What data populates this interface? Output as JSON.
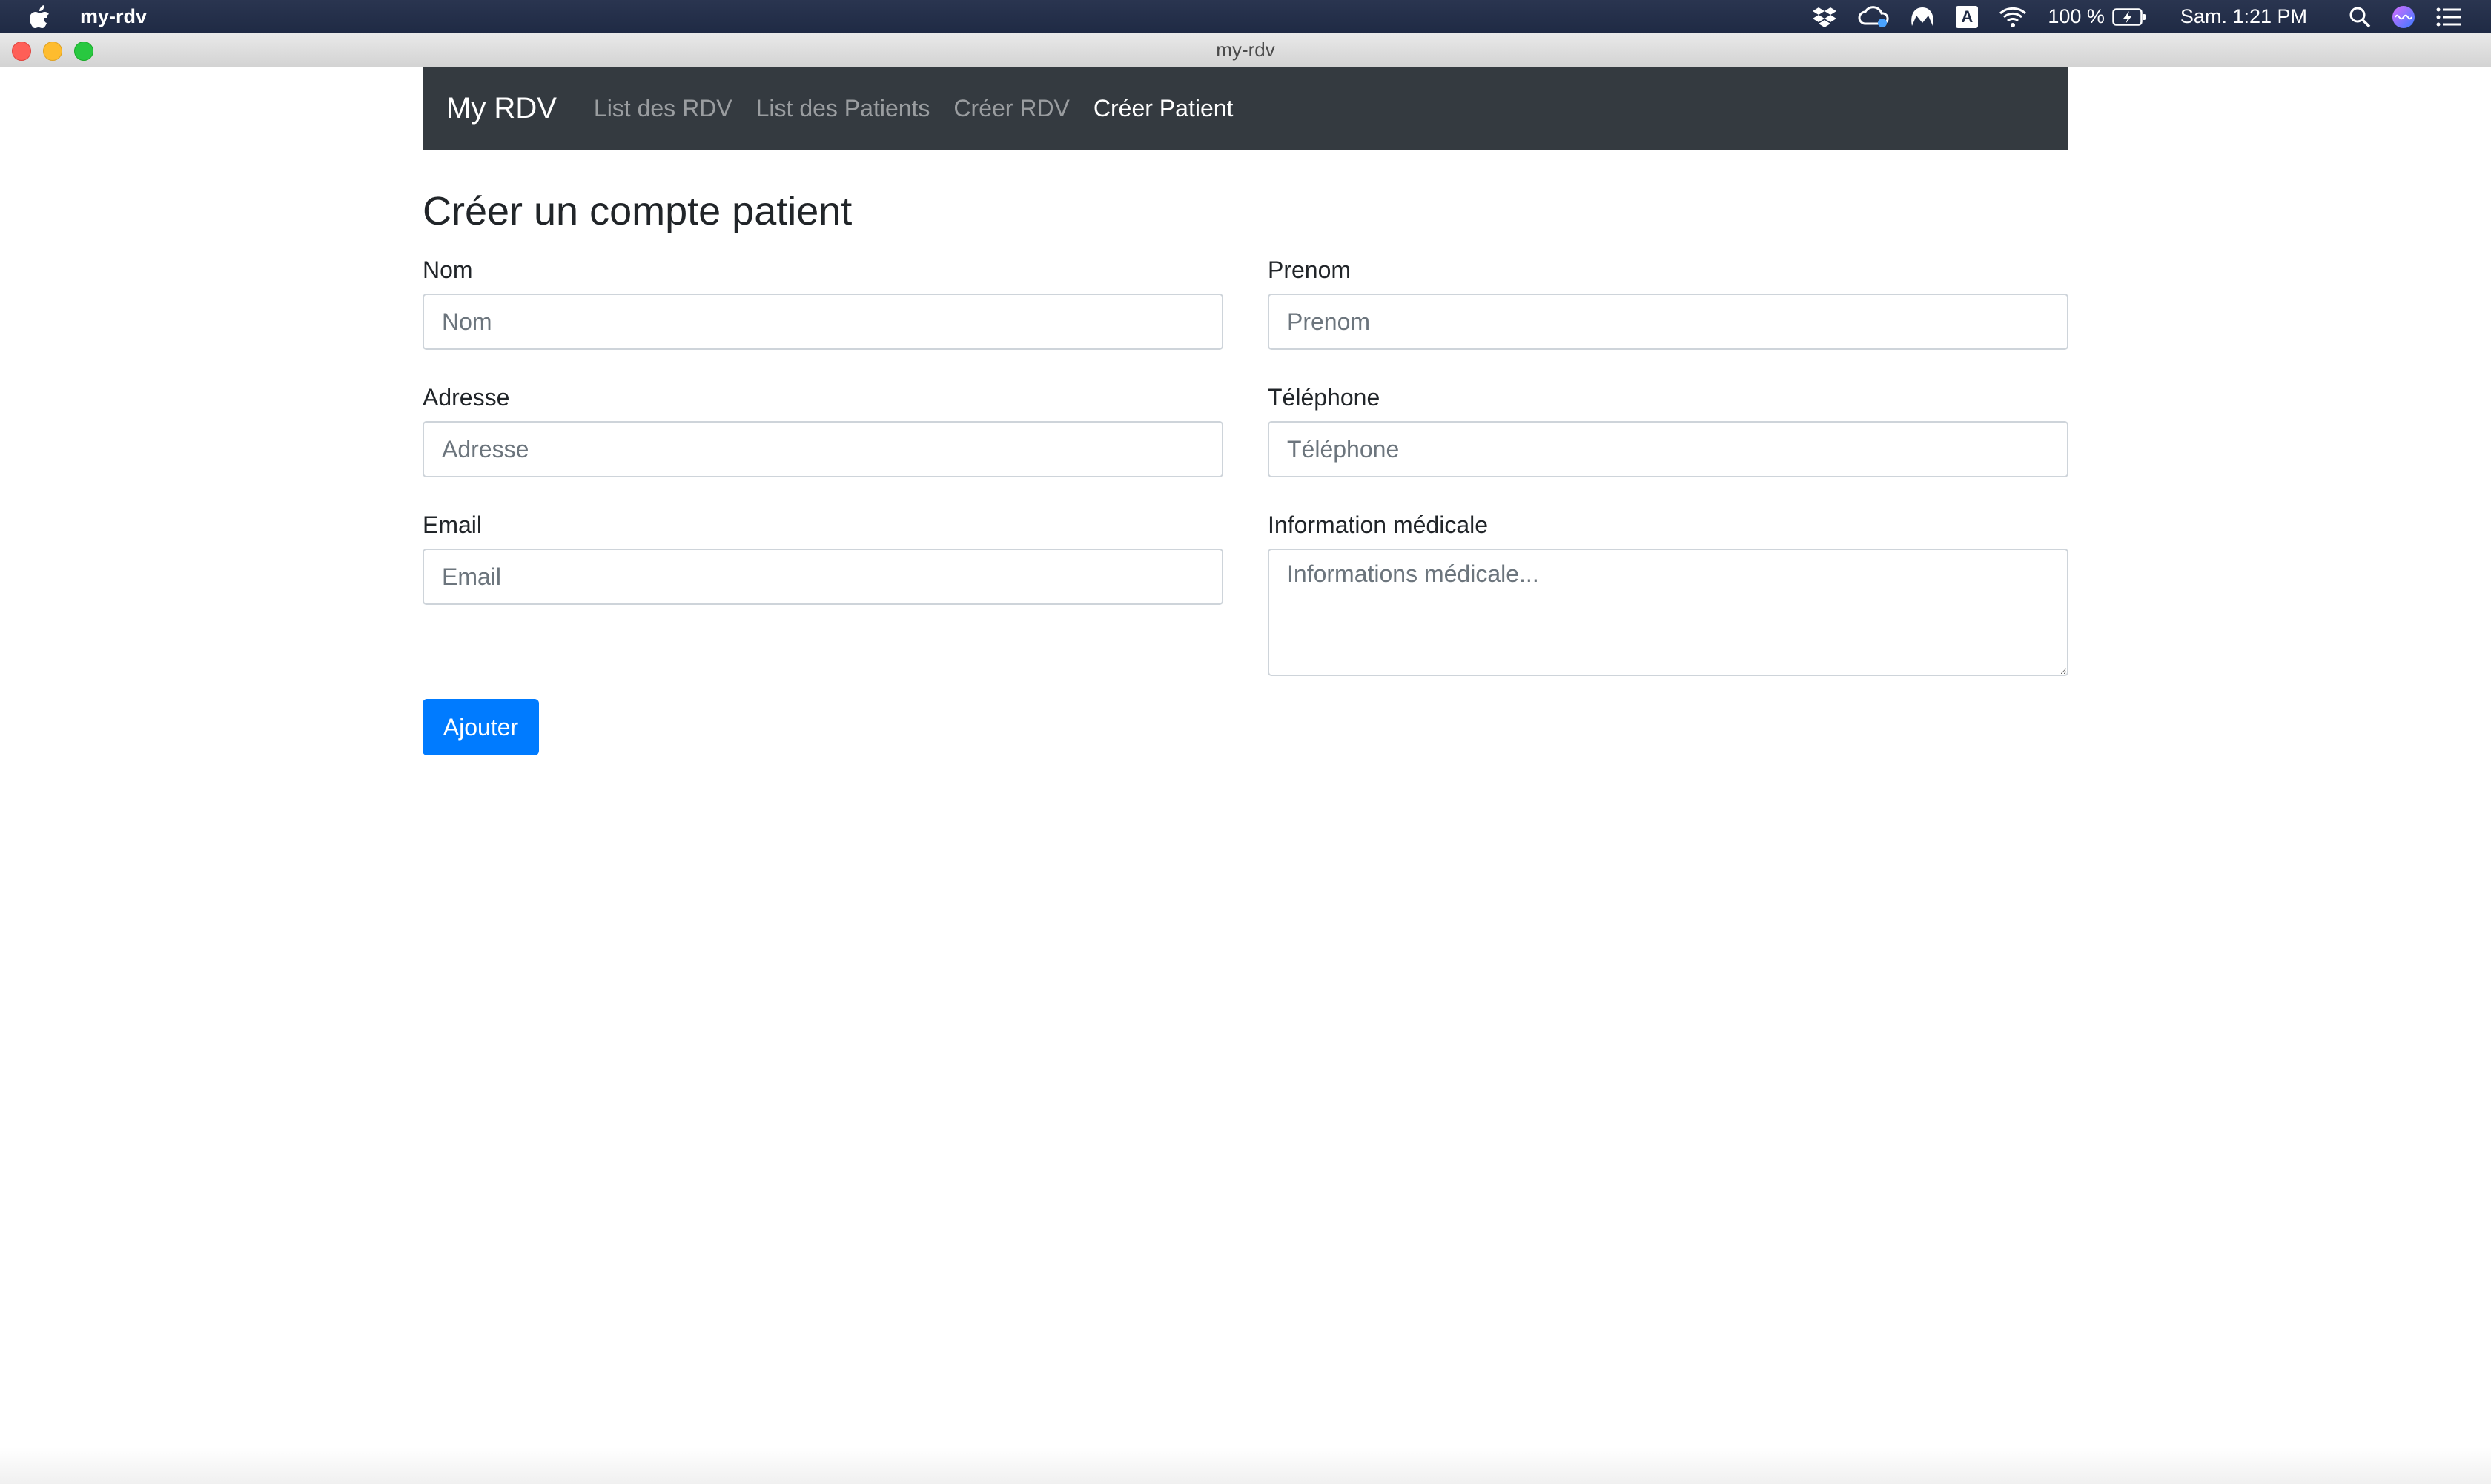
{
  "menubar": {
    "app_name": "my-rdv",
    "battery": "100 %",
    "clock": "Sam. 1:21 PM",
    "input_source": "A",
    "icons": [
      "apple-icon",
      "dropbox-icon",
      "creative-cloud-icon",
      "malwarebytes-icon",
      "input-source-icon",
      "wifi-icon",
      "battery-icon",
      "spotlight-icon",
      "siri-icon",
      "notification-center-icon"
    ]
  },
  "window": {
    "title": "my-rdv"
  },
  "navbar": {
    "brand": "My RDV",
    "links": [
      "List des RDV",
      "List des Patients",
      "Créer RDV",
      "Créer Patient"
    ],
    "active_index": 3
  },
  "form": {
    "title": "Créer un compte patient",
    "nom": {
      "label": "Nom",
      "placeholder": "Nom",
      "value": ""
    },
    "prenom": {
      "label": "Prenom",
      "placeholder": "Prenom",
      "value": ""
    },
    "adresse": {
      "label": "Adresse",
      "placeholder": "Adresse",
      "value": ""
    },
    "telephone": {
      "label": "Téléphone",
      "placeholder": "Téléphone",
      "value": ""
    },
    "email": {
      "label": "Email",
      "placeholder": "Email",
      "value": ""
    },
    "info_medicale": {
      "label": "Information médicale",
      "placeholder": "Informations médicale...",
      "value": ""
    },
    "submit_label": "Ajouter"
  },
  "colors": {
    "navbar_bg": "#343a40",
    "primary": "#007bff"
  }
}
